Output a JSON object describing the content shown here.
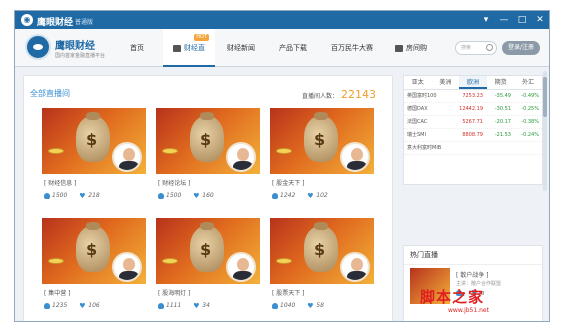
{
  "titlebar": {
    "title": "鹰眼财经",
    "edition": "普通版",
    "controls": [
      "▾",
      "—",
      "□",
      "✕"
    ]
  },
  "brand": {
    "name": "鹰眼财经",
    "subtitle": "国内首家金融直播平台"
  },
  "nav": {
    "items": [
      {
        "label": "首页",
        "active": false,
        "badge": ""
      },
      {
        "label": "财经直播",
        "active": true,
        "badge": "HOT"
      },
      {
        "label": "财经新闻",
        "active": false,
        "badge": ""
      },
      {
        "label": "产品下载",
        "active": false,
        "badge": ""
      },
      {
        "label": "百万民牛大赛",
        "active": false,
        "badge": ""
      },
      {
        "label": "房间购买",
        "active": false,
        "badge": ""
      }
    ],
    "search_placeholder": "搜索",
    "login_label": "登录/注册"
  },
  "main": {
    "section_title": "全部直播间",
    "online_label": "直播间人数：",
    "online_count": "22143",
    "cards": [
      {
        "title": "[ 财经信息 ]",
        "viewers": "1500",
        "likes": "218"
      },
      {
        "title": "[ 财经论坛 ]",
        "viewers": "1500",
        "likes": "160"
      },
      {
        "title": "[ 股金天下 ]",
        "viewers": "1242",
        "likes": "102"
      },
      {
        "title": "[ 集中营 ]",
        "viewers": "1235",
        "likes": "106"
      },
      {
        "title": "[ 股海明灯 ]",
        "viewers": "1111",
        "likes": "34"
      },
      {
        "title": "[ 股票天下 ]",
        "viewers": "1040",
        "likes": "58"
      }
    ]
  },
  "market": {
    "tabs": [
      {
        "label": "亚太",
        "active": false
      },
      {
        "label": "美洲",
        "active": false
      },
      {
        "label": "欧洲",
        "active": true
      },
      {
        "label": "期货",
        "active": false
      },
      {
        "label": "外汇",
        "active": false
      }
    ],
    "rows": [
      {
        "name": "英国富时100",
        "value": "7253.23",
        "change": "-35.49",
        "pct": "-0.49%"
      },
      {
        "name": "德国DAX",
        "value": "12442.19",
        "change": "-30.51",
        "pct": "-0.25%"
      },
      {
        "name": "法国CAC",
        "value": "5267.71",
        "change": "-20.17",
        "pct": "-0.38%"
      },
      {
        "name": "瑞士SMI",
        "value": "8808.79",
        "change": "-21.53",
        "pct": "-0.24%"
      },
      {
        "name": "意大利富时MIB",
        "value": "",
        "change": "",
        "pct": ""
      }
    ]
  },
  "hot": {
    "title": "热门直播",
    "name": "[ 散户战争 ]",
    "meta": "主讲：散户合作联盟",
    "viewers": "1",
    "likes": "33"
  },
  "watermark": {
    "text": "脚本之家",
    "url": "www.jb51.net"
  },
  "colors": {
    "titlebar": "#1f6aa5",
    "accent": "#3a8fd0",
    "count": "#f0a02a",
    "up": "#d0302a",
    "down": "#2a9a3a"
  }
}
